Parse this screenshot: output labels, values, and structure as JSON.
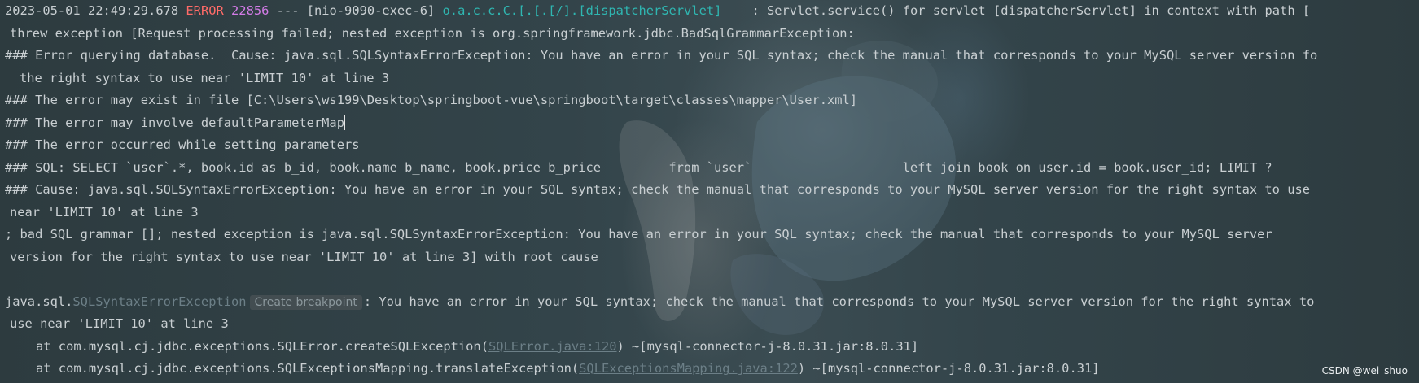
{
  "log": {
    "line1": {
      "timestamp": "2023-05-01 22:49:29.678",
      "level": "ERROR",
      "pid": "22856",
      "separator": "--- [nio-9090-exec-6]",
      "logger": "o.a.c.c.C.[.[.[/].[dispatcherServlet]",
      "message": "    : Servlet.service() for servlet [dispatcherServlet] in context with path ["
    },
    "line2": "threw exception [Request processing failed; nested exception is org.springframework.jdbc.BadSqlGrammarException:",
    "line3": "### Error querying database.  Cause: java.sql.SQLSyntaxErrorException: You have an error in your SQL syntax; check the manual that corresponds to your MySQL server version fo",
    "line4": "the right syntax to use near 'LIMIT 10' at line 3",
    "line5": "### The error may exist in file [C:\\Users\\ws199\\Desktop\\springboot-vue\\springboot\\target\\classes\\mapper\\User.xml]",
    "line6": "### The error may involve defaultParameterMap",
    "line7": "### The error occurred while setting parameters",
    "line8": "### SQL: SELECT `user`.*, book.id as b_id, book.name b_name, book.price b_price         from `user`                    left join book on user.id = book.user_id; LIMIT ?",
    "line9": "### Cause: java.sql.SQLSyntaxErrorException: You have an error in your SQL syntax; check the manual that corresponds to your MySQL server version for the right syntax to use",
    "line10": "near 'LIMIT 10' at line 3",
    "line11": "; bad SQL grammar []; nested exception is java.sql.SQLSyntaxErrorException: You have an error in your SQL syntax; check the manual that corresponds to your MySQL server",
    "line12": "version for the right syntax to use near 'LIMIT 10' at line 3] with root cause",
    "line14": {
      "prefix": "java.sql.",
      "exception_link": "SQLSyntaxErrorException",
      "breakpoint_label": "Create breakpoint",
      "message": ": You have an error in your SQL syntax; check the manual that corresponds to your MySQL server version for the right syntax to"
    },
    "line15": "use near 'LIMIT 10' at line 3",
    "line16": {
      "prefix": "at com.mysql.cj.jdbc.exceptions.SQLError.createSQLException(",
      "link": "SQLError.java:120",
      "suffix": ") ~[mysql-connector-j-8.0.31.jar:8.0.31]"
    },
    "line17": {
      "prefix": "at com.mysql.cj.jdbc.exceptions.SQLExceptionsMapping.translateException(",
      "link": "SQLExceptionsMapping.java:122",
      "suffix": ") ~[mysql-connector-j-8.0.31.jar:8.0.31]"
    }
  },
  "watermark": "CSDN @wei_shuo",
  "colors": {
    "error": "#ff6b68",
    "pid": "#d27be6",
    "logger": "#2fb6b1",
    "text": "#c9cfd2",
    "link": "#6c7f87"
  }
}
